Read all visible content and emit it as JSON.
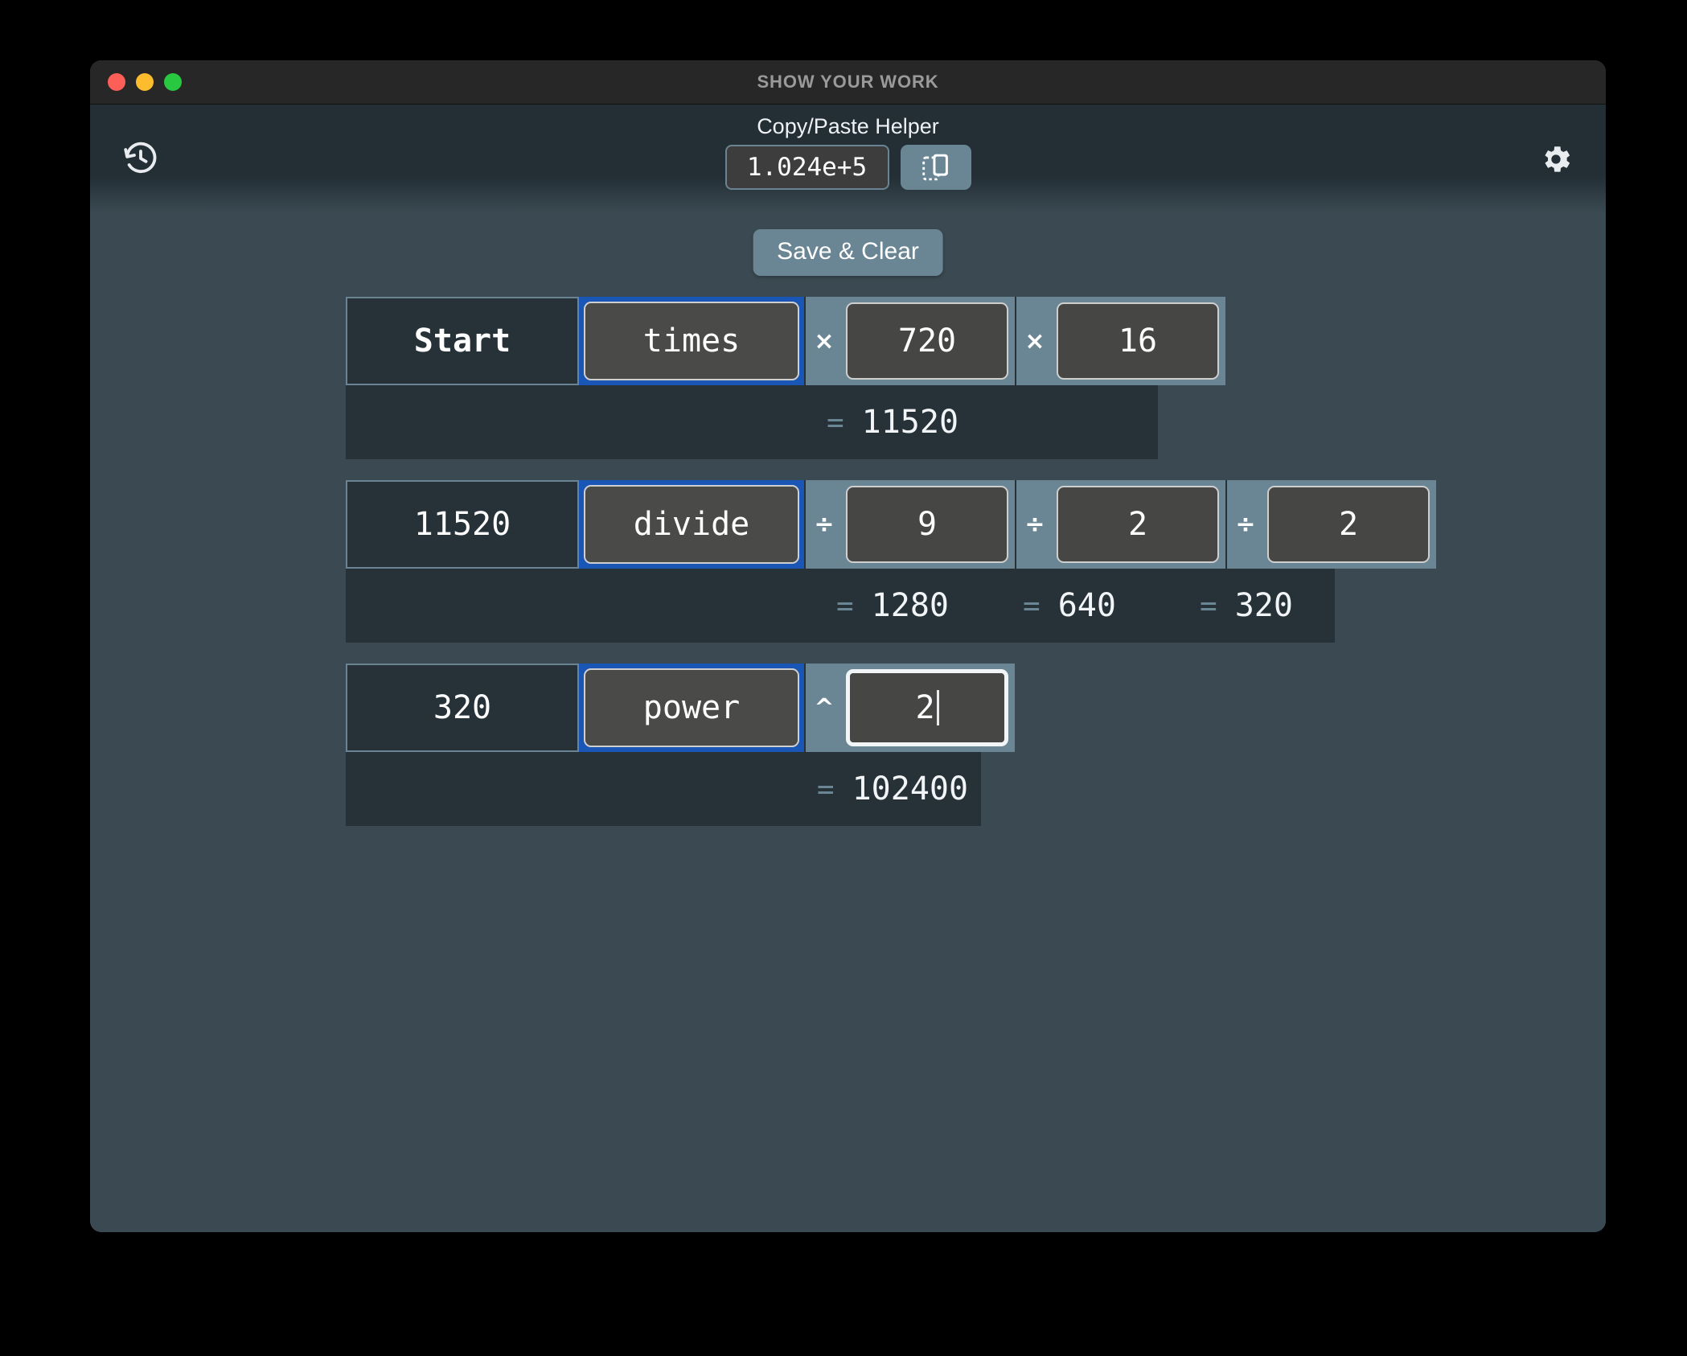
{
  "window": {
    "title": "SHOW YOUR WORK",
    "traffic_lights": [
      "close",
      "minimize",
      "zoom"
    ]
  },
  "header": {
    "history_icon": "history-icon",
    "settings_icon": "gear-icon",
    "copy_paste": {
      "label": "Copy/Paste Helper",
      "value": "1.024e+5",
      "copy_icon": "copy-icon"
    }
  },
  "toolbar": {
    "save_clear_label": "Save & Clear"
  },
  "rows": [
    {
      "start": "Start",
      "start_bold": true,
      "operation": "times",
      "operands": [
        {
          "symbol": "×",
          "value": "720"
        },
        {
          "symbol": "×",
          "value": "16"
        }
      ],
      "results": [
        {
          "eq": "=",
          "value": "11520"
        }
      ]
    },
    {
      "start": "11520",
      "start_bold": false,
      "operation": "divide",
      "operands": [
        {
          "symbol": "÷",
          "value": "9"
        },
        {
          "symbol": "÷",
          "value": "2"
        },
        {
          "symbol": "÷",
          "value": "2"
        }
      ],
      "results": [
        {
          "eq": "=",
          "value": "1280"
        },
        {
          "eq": "=",
          "value": "640"
        },
        {
          "eq": "=",
          "value": "320"
        }
      ]
    },
    {
      "start": "320",
      "start_bold": false,
      "operation": "power",
      "operands": [
        {
          "symbol": "^",
          "value": "2",
          "focused": true
        }
      ],
      "results": [
        {
          "eq": "=",
          "value": "102400"
        }
      ]
    }
  ],
  "colors": {
    "window_bg": "#3b4a52",
    "header_bg": "#232e35",
    "titlebar_bg": "#272727",
    "accent_blue": "#1a56b5",
    "operand_band": "#6a8593",
    "result_bg": "#263138",
    "input_bg": "#464644"
  }
}
